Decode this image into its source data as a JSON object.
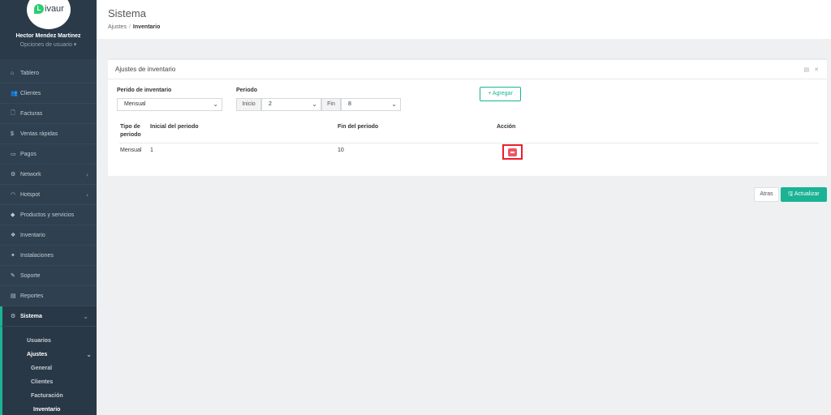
{
  "brand": {
    "logo_letter": "L",
    "logo_word": "ivaur"
  },
  "user": {
    "name": "Hector Mendez Martinez",
    "options": "Opciones de usuario ▾"
  },
  "sidebar": {
    "items": [
      {
        "label": "Tablero",
        "icon": "dashboard-icon",
        "glyph": "⌂"
      },
      {
        "label": "Clientes",
        "icon": "users-icon",
        "glyph": "👥"
      },
      {
        "label": "Facturas",
        "icon": "file-icon",
        "glyph": "🗋"
      },
      {
        "label": "Ventas rápidas",
        "icon": "dollar-icon",
        "glyph": "$"
      },
      {
        "label": "Pagos",
        "icon": "money-icon",
        "glyph": "▭"
      },
      {
        "label": "Network",
        "icon": "network-icon",
        "glyph": "⚙"
      },
      {
        "label": "Hotspot",
        "icon": "wifi-icon",
        "glyph": "◠"
      },
      {
        "label": "Productos y servicios",
        "icon": "tag-icon",
        "glyph": "◆"
      },
      {
        "label": "Inventario",
        "icon": "cubes-icon",
        "glyph": "❖"
      },
      {
        "label": "Instalaciones",
        "icon": "tools-icon",
        "glyph": "✦"
      },
      {
        "label": "Soporte",
        "icon": "wrench-icon",
        "glyph": "✎"
      },
      {
        "label": "Reportes",
        "icon": "book-icon",
        "glyph": "▤"
      },
      {
        "label": "Sistema",
        "icon": "cogs-icon",
        "glyph": "⚙"
      }
    ],
    "sub": {
      "usuarios": "Usuarios",
      "ajustes": "Ajustes",
      "general": "General",
      "clientes": "Clientes",
      "facturacion": "Facturación",
      "inventario": "Inventario"
    },
    "chevron_left": "‹",
    "chevron_down": "⌄"
  },
  "header": {
    "title": "Sistema",
    "breadcrumb_parent": "Ajustes",
    "breadcrumb_sep": "/",
    "breadcrumb_current": "Inventario"
  },
  "panel": {
    "title": "Ajustes de inventario",
    "tools": "▤ ✕",
    "period_type_label": "Perido de inventario",
    "period_type_value": "Mensual",
    "period_label": "Periodo",
    "start_addon": "Inicio",
    "start_value": "2",
    "end_addon": "Fin",
    "end_value": "8",
    "add_button": "+ Agregar",
    "select_arrow": "⌄"
  },
  "table": {
    "headers": [
      "Tipo de periodo",
      "Inicial del periodo",
      "Fin del periodo",
      "Acción"
    ],
    "rows": [
      {
        "type": "Mensual",
        "start": "1",
        "end": "10"
      }
    ]
  },
  "footer": {
    "back": "Atras",
    "update": "🖫 Actualizar"
  },
  "colors": {
    "accent": "#1ab394",
    "sidebar": "#2f4050",
    "danger": "#ed5565",
    "highlight": "#e8202f"
  }
}
